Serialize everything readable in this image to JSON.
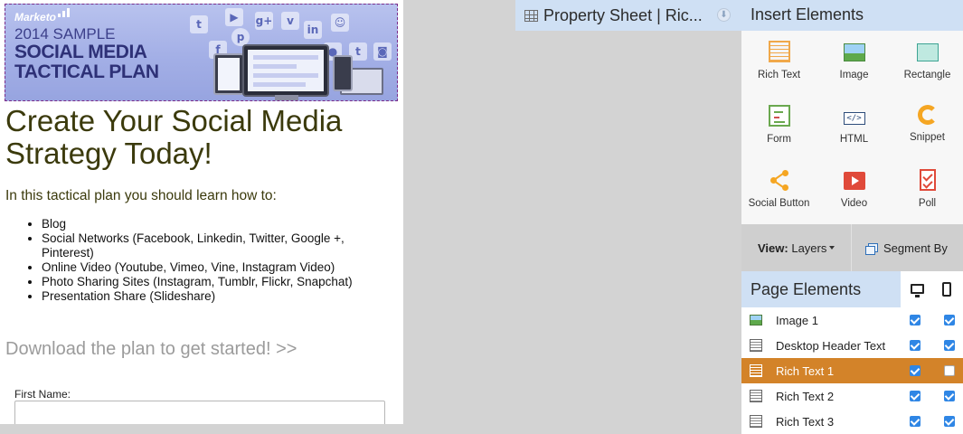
{
  "banner": {
    "logo": "Marketo",
    "line1": "2014 SAMPLE",
    "line2": "SOCIAL MEDIA",
    "line3": "TACTICAL PLAN",
    "social_icons": [
      "twitter",
      "youtube",
      "google-plus",
      "vine",
      "snapchat",
      "pinterest",
      "linkedin",
      "facebook",
      "flickr",
      "tumblr",
      "instagram"
    ]
  },
  "page": {
    "headline": "Create Your Social Media Strategy Today!",
    "intro": "In this tactical plan you should learn how to:",
    "bullets": [
      "Blog",
      "Social Networks (Facebook, Linkedin, Twitter, Google +, Pinterest)",
      "Online Video (Youtube, Vimeo, Vine, Instagram Video)",
      "Photo Sharing Sites (Instagram, Tumblr, Flickr, Snapchat)",
      "Presentation Share (Slideshare)"
    ],
    "cta": "Download the plan to get started! >>",
    "form": {
      "first_name_label": "First Name:",
      "first_name_value": ""
    }
  },
  "property_sheet": {
    "title": "Property Sheet | Ric..."
  },
  "insert_elements": {
    "title": "Insert Elements",
    "tiles": [
      {
        "label": "Rich Text",
        "icon": "rich-text-icon"
      },
      {
        "label": "Image",
        "icon": "image-icon"
      },
      {
        "label": "Rectangle",
        "icon": "rectangle-icon"
      },
      {
        "label": "Form",
        "icon": "form-icon"
      },
      {
        "label": "HTML",
        "icon": "html-icon",
        "glyph": "</>"
      },
      {
        "label": "Snippet",
        "icon": "snippet-icon"
      },
      {
        "label": "Social Button",
        "icon": "social-button-icon"
      },
      {
        "label": "Video",
        "icon": "video-icon"
      },
      {
        "label": "Poll",
        "icon": "poll-icon"
      }
    ]
  },
  "view_bar": {
    "view_prefix": "View:",
    "view_value": "Layers",
    "segment_label": "Segment By"
  },
  "page_elements": {
    "title": "Page Elements",
    "rows": [
      {
        "label": "Image 1",
        "type": "image",
        "desktop": true,
        "mobile": true,
        "selected": false
      },
      {
        "label": "Desktop Header Text",
        "type": "text",
        "desktop": true,
        "mobile": true,
        "selected": false
      },
      {
        "label": "Rich Text 1",
        "type": "text",
        "desktop": true,
        "mobile": false,
        "selected": true
      },
      {
        "label": "Rich Text 2",
        "type": "text",
        "desktop": true,
        "mobile": true,
        "selected": false
      },
      {
        "label": "Rich Text 3",
        "type": "text",
        "desktop": true,
        "mobile": true,
        "selected": false
      }
    ]
  },
  "colors": {
    "headline": "#3b3a0c",
    "header_bar": "#cfe0f4",
    "selected_row": "#d38329",
    "checkbox": "#2f86e5",
    "workspace": "#d3d3d3"
  }
}
